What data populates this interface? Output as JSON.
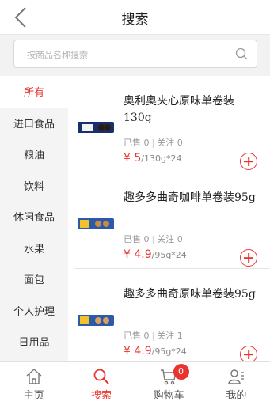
{
  "header": {
    "title": "搜索"
  },
  "search": {
    "placeholder": "按商品名称搜索"
  },
  "sidebar": {
    "items": [
      {
        "label": "所有",
        "active": true
      },
      {
        "label": "进口食品"
      },
      {
        "label": "粮油"
      },
      {
        "label": "饮料"
      },
      {
        "label": "休闲食品"
      },
      {
        "label": "水果"
      },
      {
        "label": "面包"
      },
      {
        "label": "个人护理"
      },
      {
        "label": "日用品"
      }
    ]
  },
  "products": [
    {
      "name": "奥利奥夹心原味单卷装130g",
      "sold": "已售 0",
      "follow": "关注 0",
      "price": "¥ 5",
      "unit": "/130g*24",
      "thumb_color": "#1b2f6b"
    },
    {
      "name": "趣多多曲奇咖啡单卷装95g",
      "sold": "已售 0",
      "follow": "关注 0",
      "price": "¥ 4.9",
      "unit": "/95g*24",
      "thumb_color": "#2a5aa8"
    },
    {
      "name": "趣多多曲奇原味单卷装95g",
      "sold": "已售 0",
      "follow": "关注 1",
      "price": "¥ 4.9",
      "unit": "/95g*24",
      "thumb_color": "#2a5aa8"
    }
  ],
  "tabbar": {
    "home": "主页",
    "search": "搜索",
    "cart": "购物车",
    "cart_count": "0",
    "mine": "我的"
  },
  "colors": {
    "accent": "#e8332f"
  }
}
